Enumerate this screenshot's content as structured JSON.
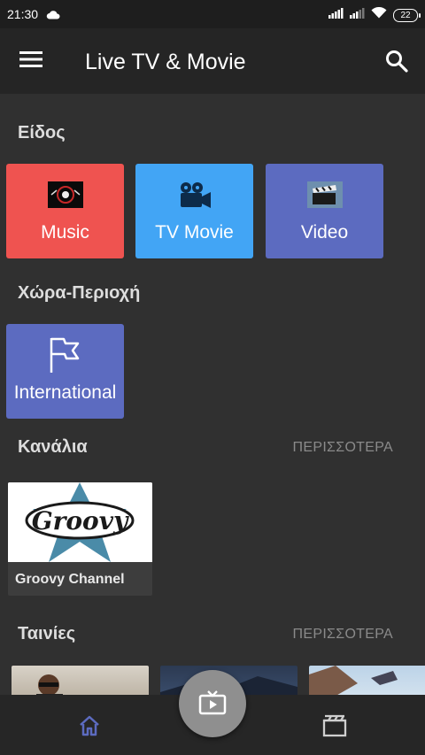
{
  "status_bar": {
    "time": "21:30",
    "battery": "22"
  },
  "app_bar": {
    "title": "Live TV & Movie"
  },
  "sections": {
    "genre": {
      "title": "Είδος",
      "items": [
        {
          "label": "Music",
          "color": "#ef5350",
          "icon": "music-thumbnail"
        },
        {
          "label": "TV Movie",
          "color": "#42a5f5",
          "icon": "film-camera-icon"
        },
        {
          "label": "Video",
          "color": "#5c6bc0",
          "icon": "clapperboard-thumbnail"
        }
      ]
    },
    "country": {
      "title": "Χώρα-Περιοχή",
      "items": [
        {
          "label": "International",
          "color": "#5c6bc0",
          "icon": "flag-icon"
        }
      ]
    },
    "channels": {
      "title": "Κανάλια",
      "more": "ΠΕΡΙΣΣΟΤΕΡΑ",
      "items": [
        {
          "name": "Groovy Channel",
          "logo_text": "Groovy"
        }
      ]
    },
    "movies": {
      "title": "Ταινίες",
      "more": "ΠΕΡΙΣΣΟΤΕΡΑ"
    }
  },
  "bottom_nav": {
    "active_color": "#5c6bc0",
    "items": [
      "home-icon",
      "tv-play-icon",
      "movie-icon"
    ]
  }
}
